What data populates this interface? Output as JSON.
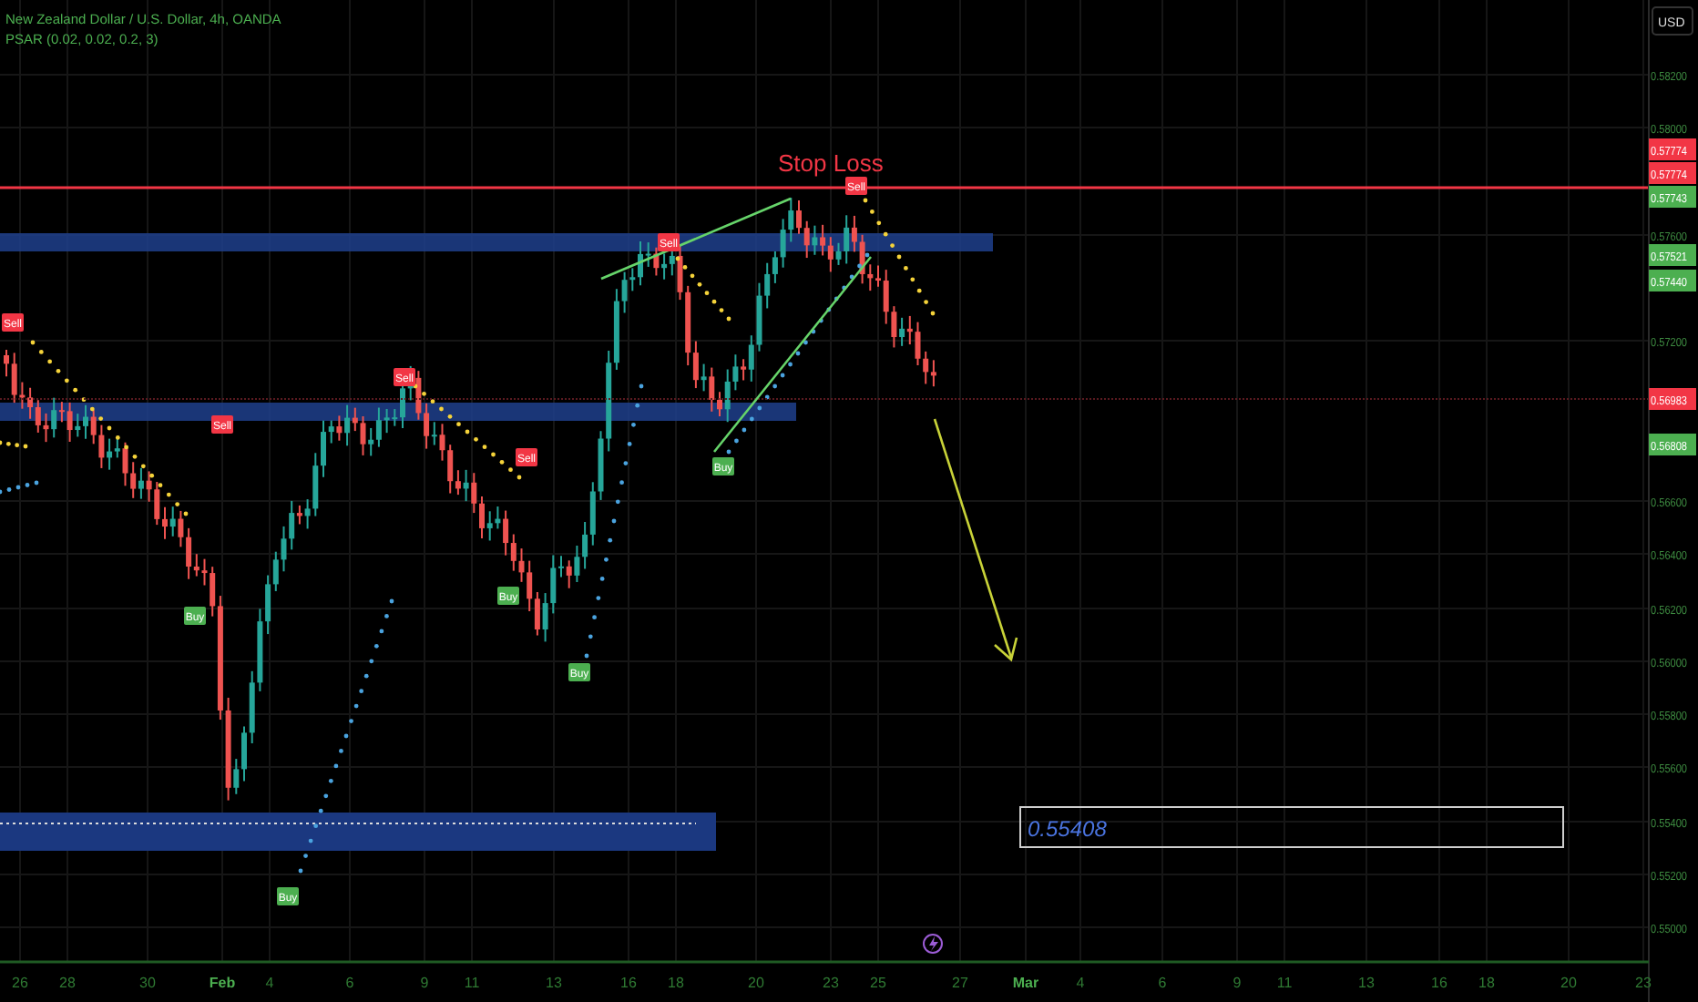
{
  "legend": {
    "symbol_line": "New Zealand Dollar / U.S. Dollar, 4h, OANDA",
    "indicator_line": "PSAR (0.02, 0.02, 0.2, 3)"
  },
  "currency_button": "USD",
  "annotations": {
    "stop_loss_label": "Stop Loss",
    "target_price": "0.55408"
  },
  "signals": [
    {
      "kind": "sell",
      "label": "Sell"
    },
    {
      "kind": "buy",
      "label": "Buy"
    },
    {
      "kind": "sell",
      "label": "Sell"
    },
    {
      "kind": "buy",
      "label": "Buy"
    },
    {
      "kind": "sell",
      "label": "Sell"
    },
    {
      "kind": "buy",
      "label": "Buy"
    },
    {
      "kind": "sell",
      "label": "Sell"
    },
    {
      "kind": "buy",
      "label": "Buy"
    },
    {
      "kind": "sell",
      "label": "Sell"
    },
    {
      "kind": "buy",
      "label": "Buy"
    },
    {
      "kind": "sell",
      "label": "Sell"
    }
  ],
  "price_axis": {
    "ticks": [
      "0.58200",
      "0.58000",
      "0.57600",
      "0.57200",
      "0.56600",
      "0.56400",
      "0.56200",
      "0.56000",
      "0.55800",
      "0.55600",
      "0.55400",
      "0.55200",
      "0.55000"
    ],
    "badges": [
      {
        "text": "0.57774",
        "color": "#f23645"
      },
      {
        "text": "0.57774",
        "color": "#f23645"
      },
      {
        "text": "0.57743",
        "color": "#4caf50"
      },
      {
        "text": "0.57521",
        "color": "#4caf50"
      },
      {
        "text": "0.57440",
        "color": "#4caf50"
      },
      {
        "text": "0.56983",
        "color": "#f23645"
      },
      {
        "text": "0.56808",
        "color": "#4caf50"
      }
    ]
  },
  "time_axis": {
    "ticks": [
      "26",
      "28",
      "30",
      "Feb",
      "4",
      "6",
      "9",
      "11",
      "13",
      "16",
      "18",
      "20",
      "23",
      "25",
      "27",
      "Mar",
      "4",
      "6",
      "9",
      "11",
      "13",
      "16",
      "18",
      "20",
      "23"
    ]
  }
}
